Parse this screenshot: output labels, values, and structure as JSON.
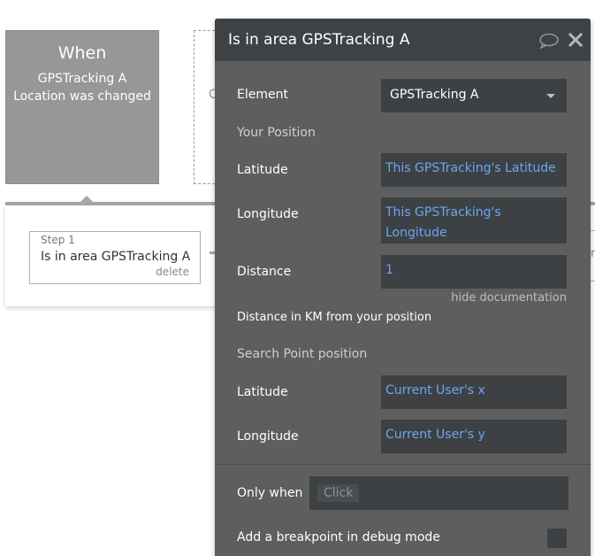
{
  "trigger": {
    "title": "When",
    "subtitle_line1": "GPSTracking A",
    "subtitle_line2": "Location was changed"
  },
  "partial_block_text": "C",
  "step": {
    "number": "Step 1",
    "name": "Is in area GPSTracking A",
    "delete_label": "delete"
  },
  "right_fragment_text": "re",
  "panel": {
    "title": "Is in area GPSTracking A",
    "header_icons": [
      "comment-icon",
      "close-icon"
    ],
    "element_label": "Element",
    "element_value": "GPSTracking A",
    "your_position_section": "Your Position",
    "latitude_label": "Latitude",
    "latitude_value": "This GPSTracking's Latitude",
    "longitude_label": "Longitude",
    "longitude_value": "This GPSTracking's Longitude",
    "distance_label": "Distance",
    "distance_value": "1",
    "hide_documentation": "hide documentation",
    "distance_doc": "Distance in KM from your position",
    "search_point_section": "Search Point position",
    "sp_latitude_label": "Latitude",
    "sp_latitude_value": "Current User's x",
    "sp_longitude_label": "Longitude",
    "sp_longitude_value": "Current User's y",
    "only_when_label": "Only when",
    "only_when_placeholder": "Click",
    "breakpoint_label": "Add a breakpoint in debug mode",
    "breakpoint_checked": false
  },
  "colors": {
    "panel_bg": "#5e5e5e",
    "header_bg": "#3f4245",
    "field_bg": "#3e4143",
    "dynamic_text": "#6aa6f2",
    "trigger_bg": "#979797"
  }
}
